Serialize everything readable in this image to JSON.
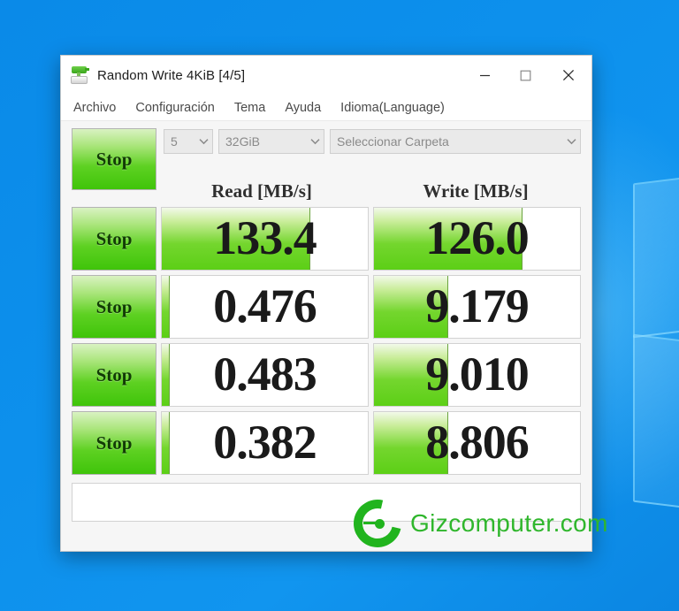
{
  "desktop": {
    "background_color": "#0d90ec",
    "wallpaper_name": "windows-10-hero-logo"
  },
  "window": {
    "title": "Random Write 4KiB [4/5]",
    "icon": "disk-benchmark-icon",
    "caption": {
      "minimize": "minimize-icon",
      "maximize": "maximize-icon",
      "close": "close-icon"
    },
    "menu": [
      {
        "label": "Archivo"
      },
      {
        "label": "Configuración"
      },
      {
        "label": "Tema"
      },
      {
        "label": "Ayuda"
      },
      {
        "label": "Idioma(Language)"
      }
    ],
    "toolbar": {
      "all_button_label": "Stop",
      "test_count": {
        "value": "5",
        "icon": "chevron-down-icon"
      },
      "test_size": {
        "value": "32GiB",
        "icon": "chevron-down-icon"
      },
      "folder": {
        "value": "Seleccionar Carpeta",
        "icon": "chevron-down-icon"
      }
    },
    "columns": {
      "read": "Read [MB/s]",
      "write": "Write [MB/s]"
    },
    "rows": [
      {
        "button": "Stop",
        "read": "133.4",
        "write": "126.0",
        "read_fill": 72,
        "write_fill": 72
      },
      {
        "button": "Stop",
        "read": "0.476",
        "write": "9.179",
        "read_fill": 4,
        "write_fill": 36
      },
      {
        "button": "Stop",
        "read": "0.483",
        "write": "9.010",
        "read_fill": 4,
        "write_fill": 36
      },
      {
        "button": "Stop",
        "read": "0.382",
        "write": "8.806",
        "read_fill": 4,
        "write_fill": 36
      }
    ],
    "status_text": ""
  },
  "watermark": {
    "text": "Gizcomputer.com",
    "logo": "gizcomputer-g-logo",
    "color": "#2fb62c"
  }
}
